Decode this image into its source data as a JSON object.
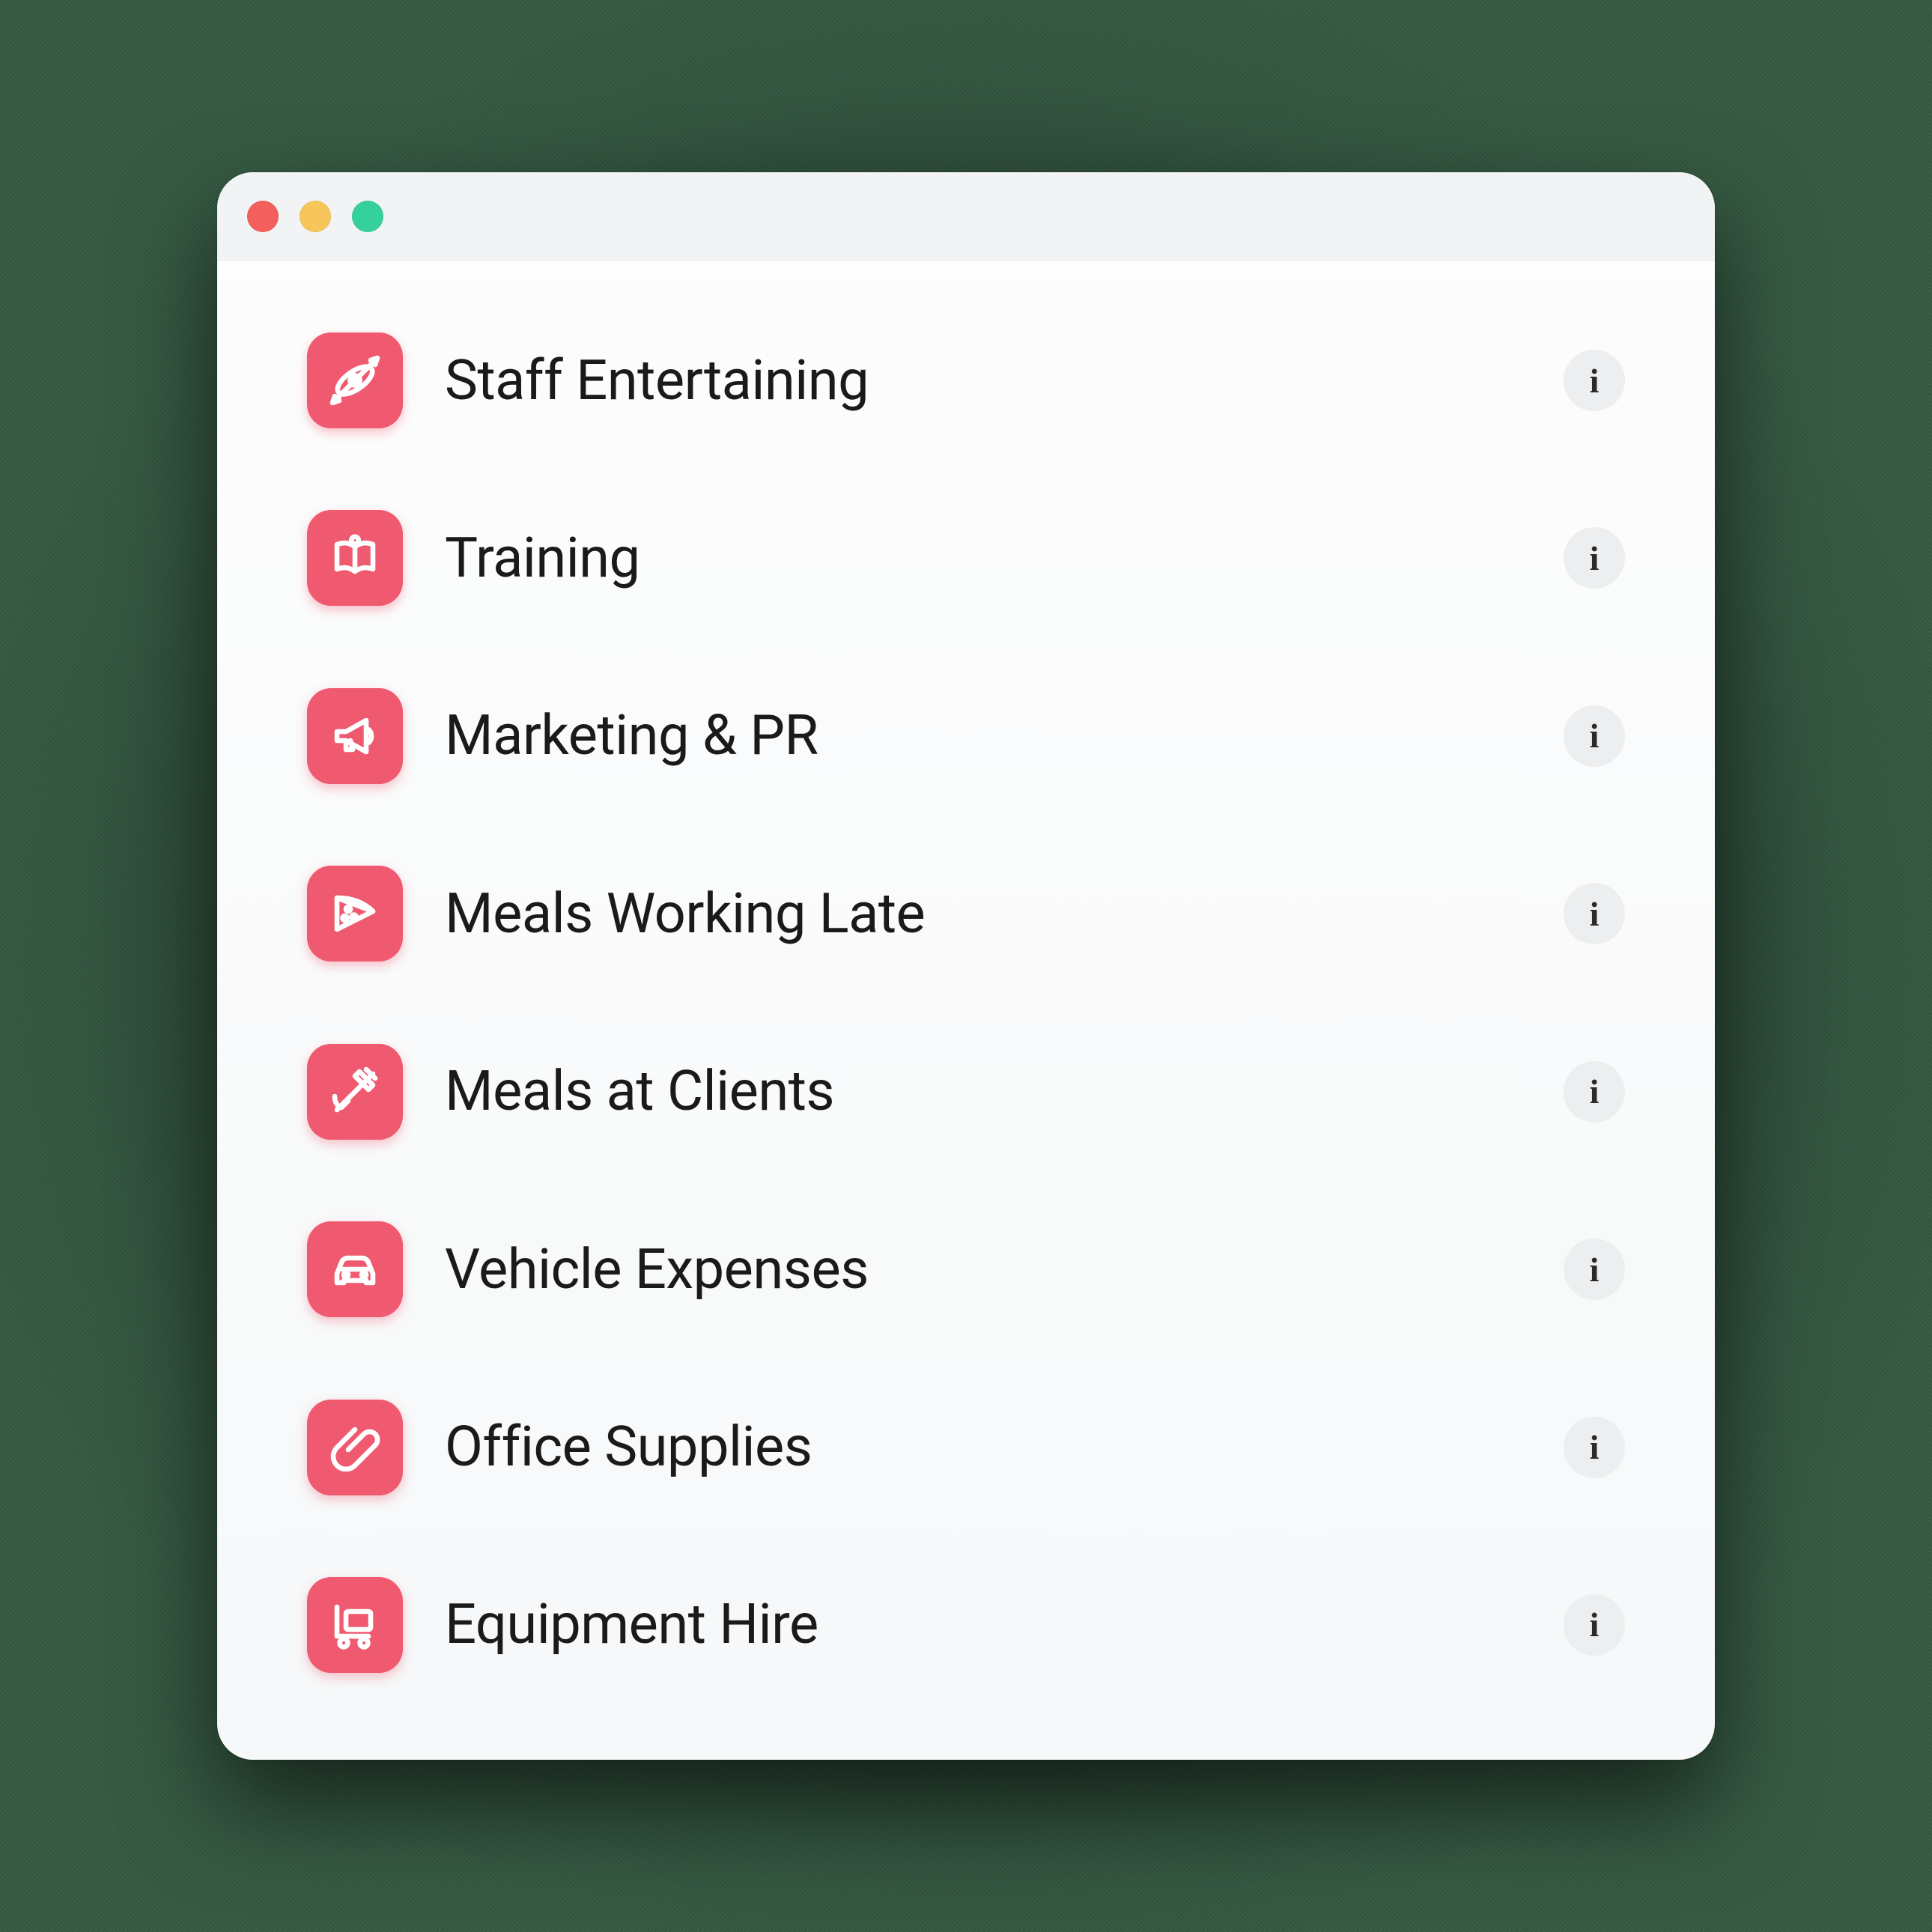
{
  "theme": {
    "accent": "#f05a70",
    "traffic_lights": {
      "red": "#f25f5c",
      "yellow": "#f7c65a",
      "green": "#34d19a"
    }
  },
  "info_glyph": "i",
  "categories": [
    {
      "icon": "kayak-icon",
      "label": "Staff Entertaining"
    },
    {
      "icon": "book-open-icon",
      "label": "Training"
    },
    {
      "icon": "megaphone-icon",
      "label": "Marketing & PR"
    },
    {
      "icon": "pizza-icon",
      "label": "Meals Working Late"
    },
    {
      "icon": "utensils-icon",
      "label": "Meals at Clients"
    },
    {
      "icon": "car-icon",
      "label": "Vehicle Expenses"
    },
    {
      "icon": "paperclip-icon",
      "label": "Office Supplies"
    },
    {
      "icon": "cart-icon",
      "label": "Equipment Hire"
    }
  ]
}
